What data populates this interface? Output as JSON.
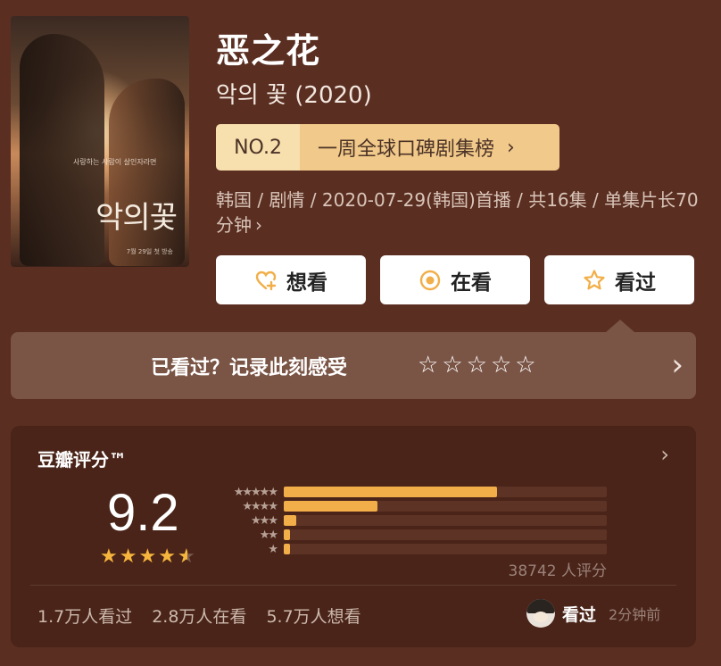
{
  "show": {
    "title": "恶之花",
    "original_title": "악의 꽃 (2020)",
    "poster_title": "악의꽃",
    "poster_tagline": "사랑하는 사람이 살인자라면",
    "poster_date": "7월 29일 첫 방송"
  },
  "rank": {
    "number": "NO.2",
    "label": "一周全球口碑剧集榜",
    "chevron": "›"
  },
  "meta": {
    "text": "韩国 / 剧情 / 2020-07-29(韩国)首播 / 共16集 / 单集片长70分钟",
    "more": "›"
  },
  "actions": [
    {
      "label": "想看",
      "icon": "heart-plus-icon"
    },
    {
      "label": "在看",
      "icon": "target-icon"
    },
    {
      "label": "看过",
      "icon": "star-outline-icon"
    }
  ],
  "rate_prompt": {
    "text": "已看过？记录此刻感受",
    "stars": [
      "☆",
      "☆",
      "☆",
      "☆",
      "☆"
    ],
    "chevron": "›"
  },
  "rating": {
    "title": "豆瓣评分™",
    "chevron": "›",
    "score": "9.2",
    "score_stars": [
      "★",
      "★",
      "★",
      "★",
      "★"
    ],
    "distribution": [
      {
        "stars": "★★★★★",
        "fraction": 0.66
      },
      {
        "stars": "★★★★",
        "fraction": 0.29
      },
      {
        "stars": "★★★",
        "fraction": 0.04
      },
      {
        "stars": "★★",
        "fraction": 0.02
      },
      {
        "stars": "★",
        "fraction": 0.02
      }
    ],
    "count": "38742 人评分",
    "stats": [
      "1.7万人看过",
      "2.8万人在看",
      "5.7万人想看"
    ],
    "friend_status": "看过",
    "friend_time": "2分钟前"
  },
  "colors": {
    "background": "#5a2e21",
    "card": "#4a2418",
    "accent": "#f2ae48"
  }
}
